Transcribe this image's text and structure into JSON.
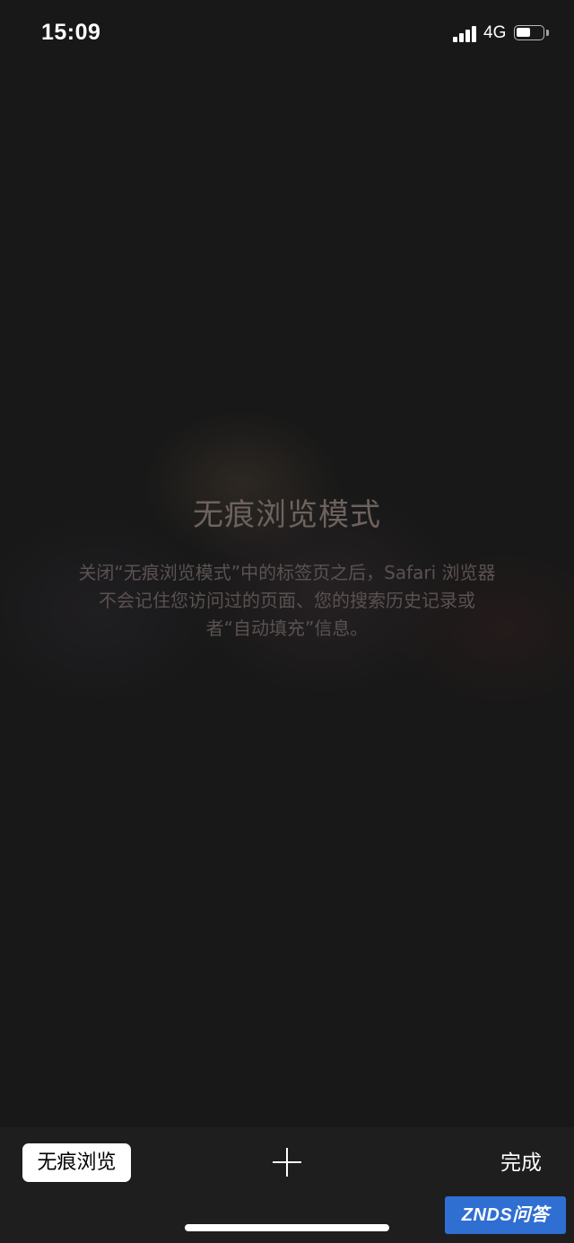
{
  "status_bar": {
    "time": "15:09",
    "network": "4G",
    "signal_bars": 4,
    "battery_fraction": 0.55,
    "signal_icon": "cellular-signal-icon",
    "battery_icon": "battery-icon"
  },
  "private_mode": {
    "title": "无痕浏览模式",
    "description_lines": [
      "关闭“无痕浏览模式”中的标签页之后，Safari 浏览器",
      "不会记住您访问过的页面、您的搜索历史记录或",
      "者“自动填充”信息。"
    ]
  },
  "toolbar": {
    "private_toggle_label": "无痕浏览",
    "new_tab_icon": "plus-icon",
    "done_label": "完成"
  },
  "watermark": {
    "text": "ZNDS问答"
  },
  "colors": {
    "background": "#181818",
    "toolbar_background": "#1e1e1f",
    "title_text": "#6d625d",
    "description_text": "#5b5151",
    "watermark_blue": "#2f6fd1"
  }
}
